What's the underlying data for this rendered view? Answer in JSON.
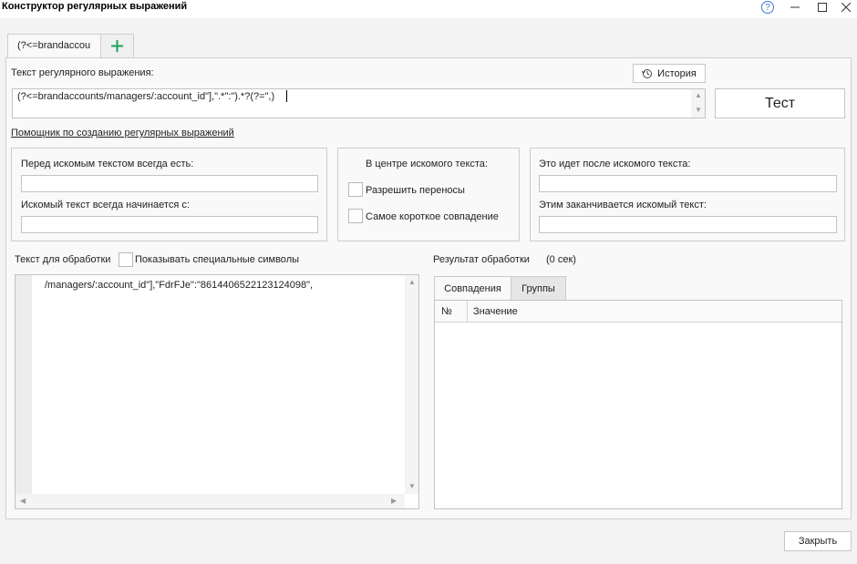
{
  "window": {
    "title": "Конструктор регулярных выражений",
    "controls": {
      "help": "?",
      "minimize": "—",
      "maximize": "☐",
      "close": "✕"
    }
  },
  "tabs": {
    "active_label": "(?<=brandaccou",
    "add_label": "+"
  },
  "regex": {
    "label": "Текст регулярного выражения:",
    "history_label": "История",
    "value": "(?<=brandaccounts/managers/:account_id\"],\".*\":\").*?(?=\",)",
    "test_button": "Тест"
  },
  "helper_link": "Помощник по созданию регулярных выражений",
  "helper": {
    "before_label": "Перед искомым текстом всегда есть:",
    "starts_label": "Искомый текст всегда начинается с:",
    "center_label": "В центре искомого текста:",
    "allow_wrap_label": "Разрешить переносы",
    "shortest_label": "Самое короткое совпадение",
    "after_label": "Это идет после искомого текста:",
    "ends_label": "Этим заканчивается искомый текст:"
  },
  "source": {
    "label": "Текст для обработки",
    "show_special_label": "Показывать специальные символы",
    "text": "/managers/:account_id\"],\"FdrFJe\":\"8614406522123124098\","
  },
  "result": {
    "label": "Результат обработки",
    "time": "(0 сек)",
    "tab_matches": "Совпадения",
    "tab_groups": "Группы",
    "col_num": "№",
    "col_value": "Значение"
  },
  "close_button": "Закрыть",
  "colors": {
    "accent_green": "#1aa35a",
    "help_blue": "#3a7bd5"
  }
}
